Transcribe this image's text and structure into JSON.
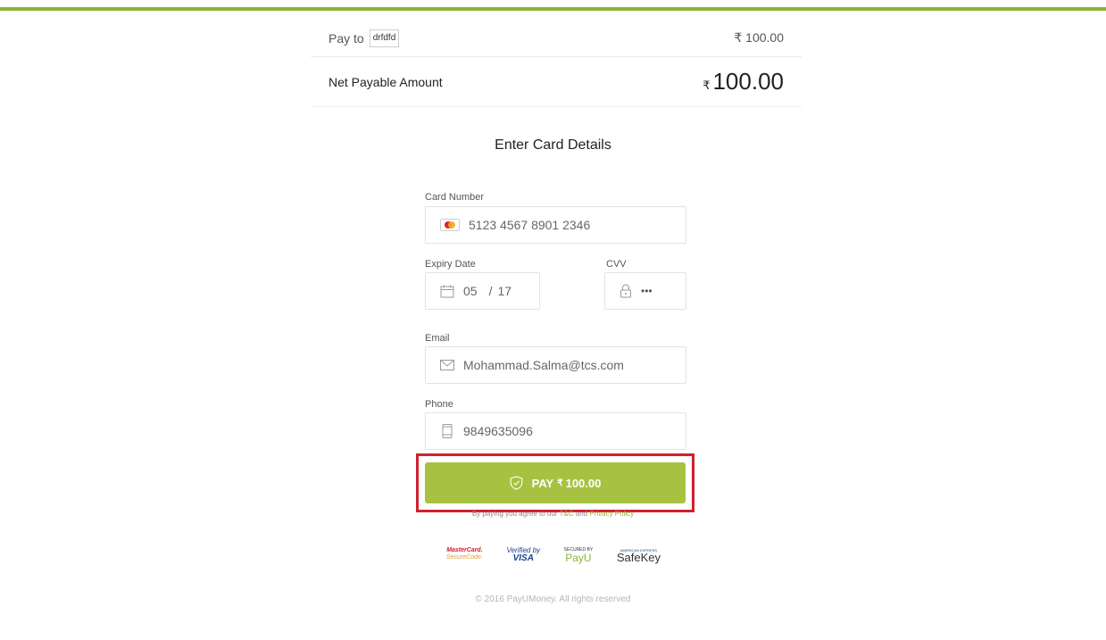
{
  "summary": {
    "pay_to_label": "Pay to",
    "merchant": "drfdfd",
    "amount": "₹ 100.00",
    "net_label": "Net Payable Amount",
    "net_currency": "₹",
    "net_value": "100.00"
  },
  "form": {
    "title": "Enter Card Details",
    "card_number_label": "Card Number",
    "card_number_value": "5123 4567 8901 2346",
    "expiry_label": "Expiry Date",
    "expiry_month": "05",
    "expiry_separator": "/",
    "expiry_year": "17",
    "cvv_label": "CVV",
    "cvv_value": "•••",
    "email_label": "Email",
    "email_value": "Mohammad.Salma@tcs.com",
    "phone_label": "Phone",
    "phone_value": "9849635096"
  },
  "pay_button": {
    "label": "PAY",
    "currency": "₹",
    "amount": "100.00"
  },
  "terms": {
    "prefix": "By paying you agree to our",
    "tc_link": "T&C",
    "and": "and",
    "privacy_link": "Privacy Policy"
  },
  "logos": {
    "mastercard_line1": "MasterCard.",
    "mastercard_line2": "SecureCode.",
    "visa_line1": "Verified by",
    "visa_line2": "VISA",
    "payu_line1": "SECURED BY",
    "payu_line2": "PayU",
    "safekey_line1": "AMERICAN EXPRESS",
    "safekey_line2": "SafeKey"
  },
  "footer": {
    "copyright": "© 2016 PayUMoney. All rights reserved"
  },
  "colors": {
    "accent": "#8db33a",
    "button": "#a6c240",
    "highlight": "#d0202e"
  }
}
